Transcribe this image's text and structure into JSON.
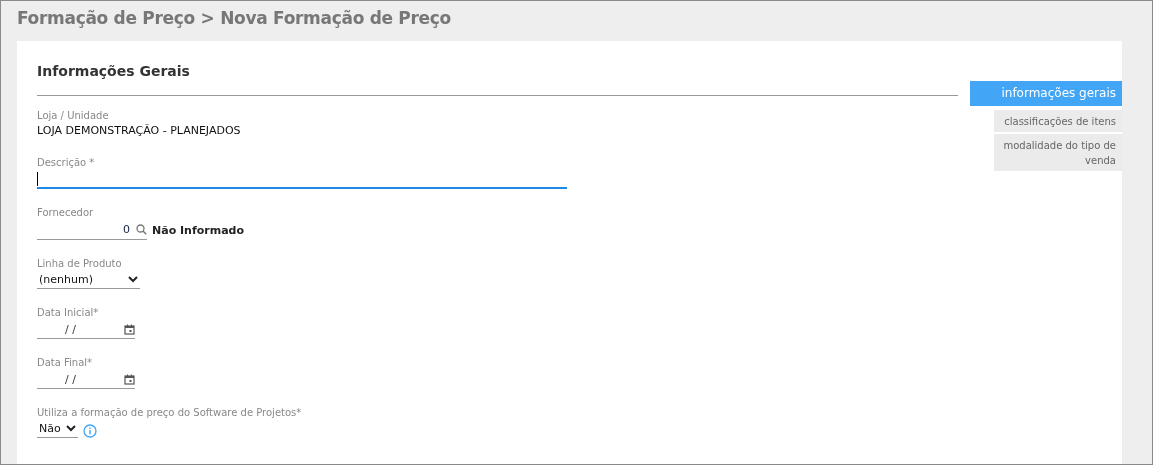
{
  "breadcrumb": "Formação de Preço > Nova Formação de Preço",
  "section_title": "Informações Gerais",
  "fields": [
    {
      "kind": "static",
      "label": "Loja / Unidade",
      "value": "LOJA DEMONSTRAÇÃO - PLANEJADOS"
    },
    {
      "kind": "text",
      "label": "Descrição *",
      "focused": true
    },
    {
      "kind": "lookup",
      "label": "Fornecedor",
      "value": "0",
      "description": "Não Informado"
    },
    {
      "kind": "select",
      "label": "Linha de Produto",
      "value": "(nenhum)"
    },
    {
      "kind": "date",
      "label": "Data Inicial*",
      "value": "/ /"
    },
    {
      "kind": "date",
      "label": "Data Final*",
      "value": "/ /"
    },
    {
      "kind": "select_info",
      "label": "Utiliza a formação de preço do Software de Projetos*",
      "value": "Não"
    }
  ],
  "nav": [
    {
      "label": "informações gerais",
      "selected": true
    },
    {
      "label": "classificações de itens",
      "selected": false
    },
    {
      "label": "modalidade do tipo de venda",
      "selected": false
    }
  ]
}
